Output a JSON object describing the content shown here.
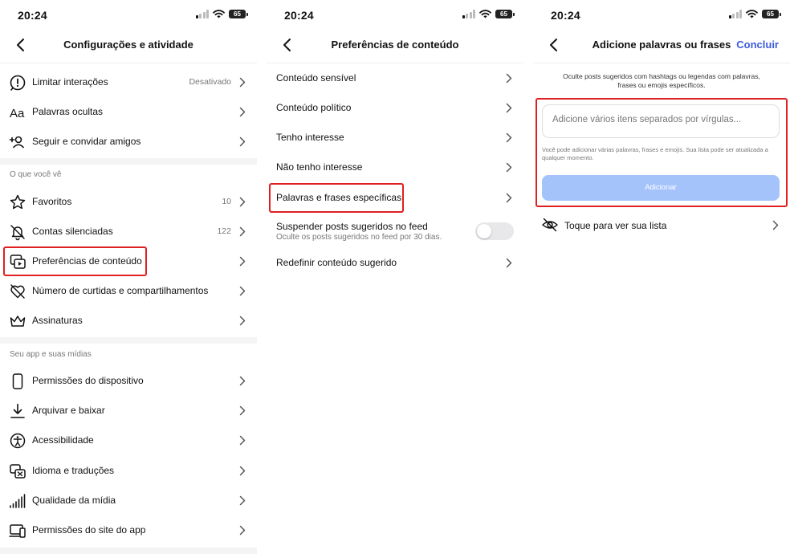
{
  "status": {
    "time": "20:24",
    "battery": "65"
  },
  "panel1": {
    "title": "Configurações e atividade",
    "items_top": [
      {
        "icon": "limit-interactions-icon",
        "label": "Limitar interações",
        "value": "Desativado"
      },
      {
        "icon": "hidden-words-icon",
        "label": "Palavras ocultas",
        "value": ""
      },
      {
        "icon": "follow-invite-icon",
        "label": "Seguir e convidar amigos",
        "value": ""
      }
    ],
    "section_what_you_see": "O que você vê",
    "items_see": [
      {
        "icon": "star-icon",
        "label": "Favoritos",
        "value": "10"
      },
      {
        "icon": "muted-bell-icon",
        "label": "Contas silenciadas",
        "value": "122"
      },
      {
        "icon": "content-preferences-icon",
        "label": "Preferências de conteúdo",
        "value": ""
      },
      {
        "icon": "heart-off-icon",
        "label": "Número de curtidas e compartilhamentos",
        "value": ""
      },
      {
        "icon": "crown-icon",
        "label": "Assinaturas",
        "value": ""
      }
    ],
    "section_app_media": "Seu app e suas mídias",
    "items_app": [
      {
        "icon": "phone-icon",
        "label": "Permissões do dispositivo",
        "value": ""
      },
      {
        "icon": "download-icon",
        "label": "Arquivar e baixar",
        "value": ""
      },
      {
        "icon": "accessibility-icon",
        "label": "Acessibilidade",
        "value": ""
      },
      {
        "icon": "translate-icon",
        "label": "Idioma e traduções",
        "value": ""
      },
      {
        "icon": "signal-bars-icon",
        "label": "Qualidade da mídia",
        "value": ""
      },
      {
        "icon": "laptop-icon",
        "label": "Permissões do site do app",
        "value": ""
      }
    ]
  },
  "panel2": {
    "title": "Preferências de conteúdo",
    "items": [
      {
        "label": "Conteúdo sensível"
      },
      {
        "label": "Conteúdo político"
      },
      {
        "label": "Tenho interesse"
      },
      {
        "label": "Não tenho interesse"
      },
      {
        "label": "Palavras e frases específicas"
      }
    ],
    "suspend_label": "Suspender posts sugeridos no feed",
    "suspend_sub": "Oculte os posts sugeridos no feed por 30 dias.",
    "suspend_on": false,
    "reset_label": "Redefinir conteúdo sugerido"
  },
  "panel3": {
    "title": "Adicione palavras ou frases",
    "done": "Concluir",
    "intro": "Oculte posts sugeridos com hashtags ou legendas com palavras, frases ou emojis específicos.",
    "input_placeholder": "Adicione vários itens separados por vírgulas...",
    "input_value": "",
    "helper": "Você pode adicionar várias palavras, frases e emojis. Sua lista pode ser atualizada a qualquer momento.",
    "add_button": "Adicionar",
    "list_row": "Toque para ver sua lista"
  },
  "colors": {
    "accent": "#3b5bdb",
    "highlight": "#e02020",
    "button_disabled": "#a5c3fb"
  }
}
